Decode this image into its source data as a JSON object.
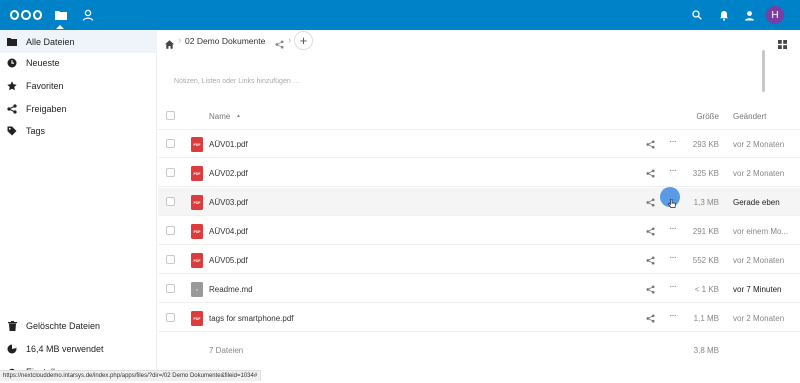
{
  "header": {
    "avatar_initial": "H",
    "accent": "#0082c9"
  },
  "sidebar": {
    "items": [
      {
        "label": "Alle Dateien",
        "icon": "folder-icon"
      },
      {
        "label": "Neueste",
        "icon": "clock-icon"
      },
      {
        "label": "Favoriten",
        "icon": "star-icon"
      },
      {
        "label": "Freigaben",
        "icon": "share-icon"
      },
      {
        "label": "Tags",
        "icon": "tag-icon"
      }
    ],
    "trash": "Gelöschte Dateien",
    "usage": "16,4 MB verwendet",
    "settings": "Einstellungen"
  },
  "breadcrumb": {
    "folder": "02 Demo Dokumente"
  },
  "notes_placeholder": "Notizen, Listen oder Links hinzufügen …",
  "table": {
    "headers": {
      "name": "Name",
      "size": "Größe",
      "modified": "Geändert"
    },
    "rows": [
      {
        "name": "AÜV01.pdf",
        "type": "pdf",
        "size": "293 KB",
        "modified": "vor 2 Monaten"
      },
      {
        "name": "AÜV02.pdf",
        "type": "pdf",
        "size": "325 KB",
        "modified": "vor 2 Monaten"
      },
      {
        "name": "AÜV03.pdf",
        "type": "pdf",
        "size": "1,3 MB",
        "modified": "Gerade eben"
      },
      {
        "name": "AÜV04.pdf",
        "type": "pdf",
        "size": "291 KB",
        "modified": "vor einem Mo..."
      },
      {
        "name": "AÜV05.pdf",
        "type": "pdf",
        "size": "552 KB",
        "modified": "vor 2 Monaten"
      },
      {
        "name": "Readme.md",
        "type": "md",
        "size": "< 1 KB",
        "modified": "vor 7 Minuten"
      },
      {
        "name": "tags for smartphone.pdf",
        "type": "pdf",
        "size": "1,1 MB",
        "modified": "vor 2 Monaten"
      }
    ],
    "summary": {
      "count": "7 Dateien",
      "total": "3,8 MB"
    }
  },
  "file_icon_labels": {
    "pdf": "PDF",
    "md": "≡"
  },
  "status_url": "https://nextclouddemo.intarsys.de/index.php/apps/files/?dir=/02 Demo Dokumente&fileid=1034#"
}
